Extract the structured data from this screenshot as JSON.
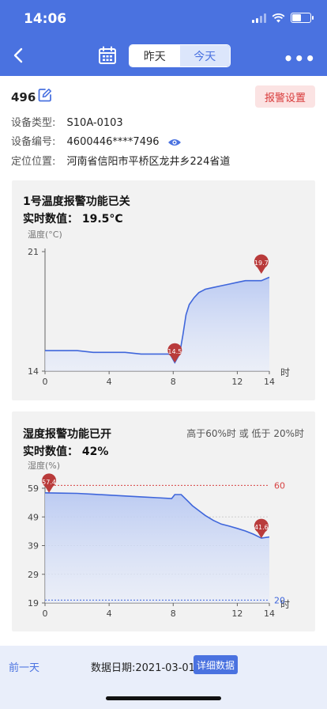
{
  "status": {
    "time": "14:06"
  },
  "nav": {
    "seg_yesterday": "昨天",
    "seg_today": "今天",
    "more": "•••"
  },
  "device": {
    "name": "496",
    "alarm_settings": "报警设置",
    "type_label": "设备类型:",
    "type_value": "S10A-0103",
    "id_label": "设备编号:",
    "id_value": "4600446****7496",
    "location_label": "定位位置:",
    "location_value": "河南省信阳市平桥区龙井乡224省道"
  },
  "temp_card": {
    "title": "1号温度报警功能已关",
    "value_text": "实时数值：  19.5°C"
  },
  "hum_card": {
    "title": "湿度报警功能已开",
    "value_text": "实时数值：  42%",
    "threshold_note": "高于60%时 或 低于 20%时"
  },
  "bottom": {
    "prev_day": "前一天",
    "data_date": "数据日期:2021-03-01",
    "detail": "详细数据"
  },
  "colors": {
    "accent": "#4a72e0",
    "line": "#3f66db",
    "marker": "#b93b3b",
    "upper_limit": "#d84343",
    "lower_limit": "#3f66db"
  },
  "chart_data": [
    {
      "type": "area",
      "ylabel": "温度(°C)",
      "xlabel": "时",
      "xlim": [
        0,
        14
      ],
      "ylim": [
        14,
        21
      ],
      "xticks": [
        "0",
        "4",
        "8",
        "12",
        "14"
      ],
      "yticks": [
        "21",
        "14"
      ],
      "x": [
        0,
        0.5,
        1,
        2,
        3,
        4,
        5,
        6,
        7,
        7.8,
        8.1,
        8.4,
        8.6,
        8.8,
        9.0,
        9.3,
        9.6,
        10,
        10.5,
        11,
        11.5,
        12,
        12.5,
        13,
        13.5,
        14
      ],
      "y": [
        15.2,
        15.2,
        15.2,
        15.2,
        15.1,
        15.1,
        15.1,
        15.0,
        15.0,
        15.0,
        14.5,
        15.0,
        16.1,
        17.3,
        17.9,
        18.3,
        18.6,
        18.8,
        18.9,
        19.0,
        19.1,
        19.2,
        19.3,
        19.3,
        19.3,
        19.5
      ],
      "markers": [
        {
          "x": 8.1,
          "y": 14.5,
          "label": "14.5"
        },
        {
          "x": 13.5,
          "y": 19.7,
          "label": "19.7"
        }
      ]
    },
    {
      "type": "area",
      "ylabel": "湿度(%)",
      "xlabel": "时",
      "xlim": [
        0,
        14
      ],
      "ylim": [
        19,
        59
      ],
      "xticks": [
        "0",
        "4",
        "8",
        "12",
        "14"
      ],
      "yticks": [
        "59",
        "49",
        "39",
        "29",
        "19"
      ],
      "x": [
        0,
        1,
        2,
        3,
        4,
        5,
        6,
        7,
        7.9,
        8.1,
        8.5,
        8.9,
        9.2,
        9.6,
        10,
        10.5,
        11,
        11.5,
        12,
        12.5,
        13,
        13.5,
        14
      ],
      "y": [
        57.4,
        57.3,
        57.2,
        56.9,
        56.6,
        56.3,
        56.0,
        55.7,
        55.4,
        56.8,
        56.8,
        54.6,
        52.9,
        51.2,
        49.5,
        47.8,
        46.5,
        45.8,
        45.0,
        44.1,
        43.0,
        41.6,
        42.0
      ],
      "thresholds": [
        {
          "value": 60,
          "label": "60",
          "kind": "upper"
        },
        {
          "value": 20,
          "label": "20",
          "kind": "lower"
        }
      ],
      "markers": [
        {
          "x": 0.25,
          "y": 57.4,
          "label": "57.4"
        },
        {
          "x": 13.5,
          "y": 41.6,
          "label": "41.6"
        }
      ]
    }
  ]
}
